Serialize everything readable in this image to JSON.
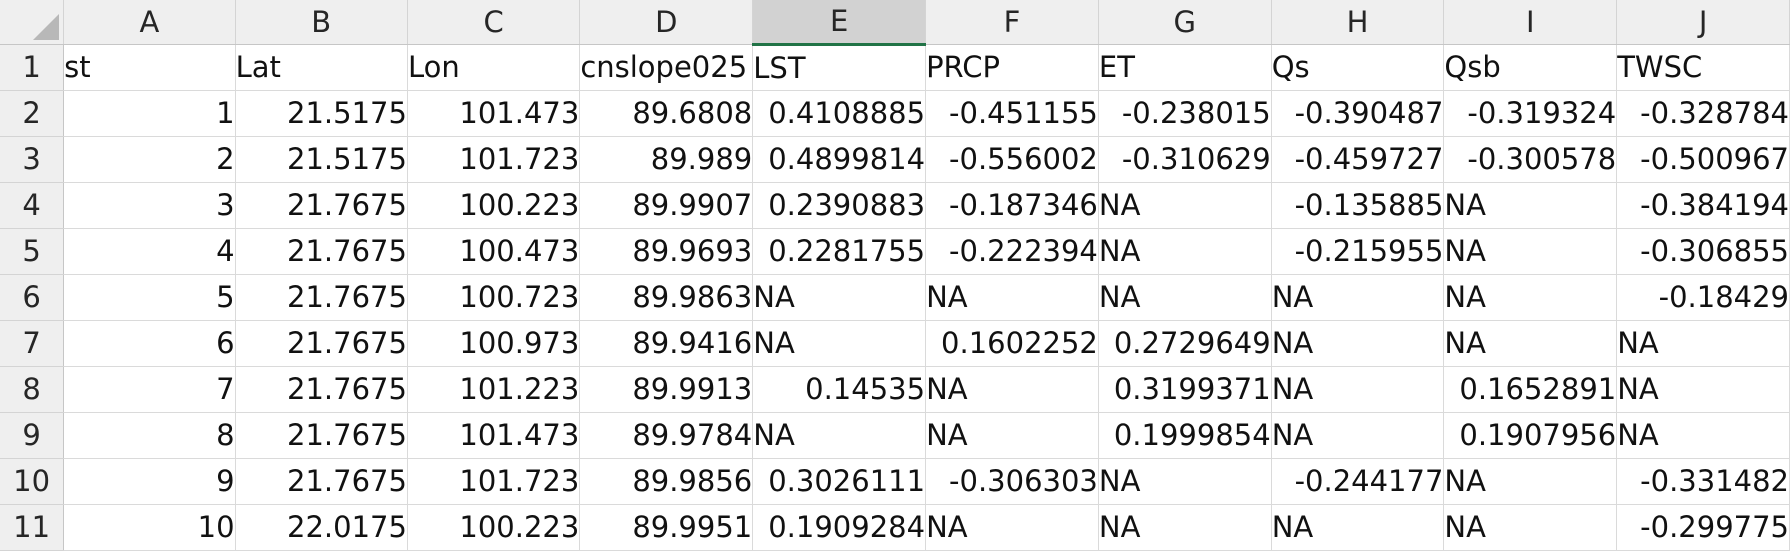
{
  "column_headers": [
    "A",
    "B",
    "C",
    "D",
    "E",
    "F",
    "G",
    "H",
    "I",
    "J"
  ],
  "selected_column": "E",
  "rows": [
    {
      "row": "1",
      "cells": [
        {
          "v": "st",
          "t": "txt"
        },
        {
          "v": "Lat",
          "t": "txt"
        },
        {
          "v": "Lon",
          "t": "txt"
        },
        {
          "v": "cnslope025",
          "t": "txt"
        },
        {
          "v": "LST",
          "t": "txt"
        },
        {
          "v": "PRCP",
          "t": "txt"
        },
        {
          "v": "ET",
          "t": "txt"
        },
        {
          "v": "Qs",
          "t": "txt"
        },
        {
          "v": "Qsb",
          "t": "txt"
        },
        {
          "v": "TWSC",
          "t": "txt"
        }
      ]
    },
    {
      "row": "2",
      "cells": [
        {
          "v": "1",
          "t": "num"
        },
        {
          "v": "21.5175",
          "t": "num"
        },
        {
          "v": "101.473",
          "t": "num"
        },
        {
          "v": "89.6808",
          "t": "num"
        },
        {
          "v": "0.4108885",
          "t": "num"
        },
        {
          "v": "-0.451155",
          "t": "num"
        },
        {
          "v": "-0.238015",
          "t": "num"
        },
        {
          "v": "-0.390487",
          "t": "num"
        },
        {
          "v": "-0.319324",
          "t": "num"
        },
        {
          "v": "-0.328784",
          "t": "num"
        }
      ]
    },
    {
      "row": "3",
      "cells": [
        {
          "v": "2",
          "t": "num"
        },
        {
          "v": "21.5175",
          "t": "num"
        },
        {
          "v": "101.723",
          "t": "num"
        },
        {
          "v": "89.989",
          "t": "num"
        },
        {
          "v": "0.4899814",
          "t": "num"
        },
        {
          "v": "-0.556002",
          "t": "num"
        },
        {
          "v": "-0.310629",
          "t": "num"
        },
        {
          "v": "-0.459727",
          "t": "num"
        },
        {
          "v": "-0.300578",
          "t": "num"
        },
        {
          "v": "-0.500967",
          "t": "num"
        }
      ]
    },
    {
      "row": "4",
      "cells": [
        {
          "v": "3",
          "t": "num"
        },
        {
          "v": "21.7675",
          "t": "num"
        },
        {
          "v": "100.223",
          "t": "num"
        },
        {
          "v": "89.9907",
          "t": "num"
        },
        {
          "v": "0.2390883",
          "t": "num"
        },
        {
          "v": "-0.187346",
          "t": "num"
        },
        {
          "v": "NA",
          "t": "txt"
        },
        {
          "v": "-0.135885",
          "t": "num"
        },
        {
          "v": "NA",
          "t": "txt"
        },
        {
          "v": "-0.384194",
          "t": "num"
        }
      ]
    },
    {
      "row": "5",
      "cells": [
        {
          "v": "4",
          "t": "num"
        },
        {
          "v": "21.7675",
          "t": "num"
        },
        {
          "v": "100.473",
          "t": "num"
        },
        {
          "v": "89.9693",
          "t": "num"
        },
        {
          "v": "0.2281755",
          "t": "num"
        },
        {
          "v": "-0.222394",
          "t": "num"
        },
        {
          "v": "NA",
          "t": "txt"
        },
        {
          "v": "-0.215955",
          "t": "num"
        },
        {
          "v": "NA",
          "t": "txt"
        },
        {
          "v": "-0.306855",
          "t": "num"
        }
      ]
    },
    {
      "row": "6",
      "cells": [
        {
          "v": "5",
          "t": "num"
        },
        {
          "v": "21.7675",
          "t": "num"
        },
        {
          "v": "100.723",
          "t": "num"
        },
        {
          "v": "89.9863",
          "t": "num"
        },
        {
          "v": "NA",
          "t": "txt"
        },
        {
          "v": "NA",
          "t": "txt"
        },
        {
          "v": "NA",
          "t": "txt"
        },
        {
          "v": "NA",
          "t": "txt"
        },
        {
          "v": "NA",
          "t": "txt"
        },
        {
          "v": "-0.18429",
          "t": "num"
        }
      ]
    },
    {
      "row": "7",
      "cells": [
        {
          "v": "6",
          "t": "num"
        },
        {
          "v": "21.7675",
          "t": "num"
        },
        {
          "v": "100.973",
          "t": "num"
        },
        {
          "v": "89.9416",
          "t": "num"
        },
        {
          "v": "NA",
          "t": "txt"
        },
        {
          "v": "0.1602252",
          "t": "num"
        },
        {
          "v": "0.2729649",
          "t": "num"
        },
        {
          "v": "NA",
          "t": "txt"
        },
        {
          "v": "NA",
          "t": "txt"
        },
        {
          "v": "NA",
          "t": "txt"
        }
      ]
    },
    {
      "row": "8",
      "cells": [
        {
          "v": "7",
          "t": "num"
        },
        {
          "v": "21.7675",
          "t": "num"
        },
        {
          "v": "101.223",
          "t": "num"
        },
        {
          "v": "89.9913",
          "t": "num"
        },
        {
          "v": "0.14535",
          "t": "num"
        },
        {
          "v": "NA",
          "t": "txt"
        },
        {
          "v": "0.3199371",
          "t": "num"
        },
        {
          "v": "NA",
          "t": "txt"
        },
        {
          "v": "0.1652891",
          "t": "num"
        },
        {
          "v": "NA",
          "t": "txt"
        }
      ]
    },
    {
      "row": "9",
      "cells": [
        {
          "v": "8",
          "t": "num"
        },
        {
          "v": "21.7675",
          "t": "num"
        },
        {
          "v": "101.473",
          "t": "num"
        },
        {
          "v": "89.9784",
          "t": "num"
        },
        {
          "v": "NA",
          "t": "txt"
        },
        {
          "v": "NA",
          "t": "txt"
        },
        {
          "v": "0.1999854",
          "t": "num"
        },
        {
          "v": "NA",
          "t": "txt"
        },
        {
          "v": "0.1907956",
          "t": "num"
        },
        {
          "v": "NA",
          "t": "txt"
        }
      ]
    },
    {
      "row": "10",
      "cells": [
        {
          "v": "9",
          "t": "num"
        },
        {
          "v": "21.7675",
          "t": "num"
        },
        {
          "v": "101.723",
          "t": "num"
        },
        {
          "v": "89.9856",
          "t": "num"
        },
        {
          "v": "0.3026111",
          "t": "num"
        },
        {
          "v": "-0.306303",
          "t": "num"
        },
        {
          "v": "NA",
          "t": "txt"
        },
        {
          "v": "-0.244177",
          "t": "num"
        },
        {
          "v": "NA",
          "t": "txt"
        },
        {
          "v": "-0.331482",
          "t": "num"
        }
      ]
    },
    {
      "row": "11",
      "cells": [
        {
          "v": "10",
          "t": "num"
        },
        {
          "v": "22.0175",
          "t": "num"
        },
        {
          "v": "100.223",
          "t": "num"
        },
        {
          "v": "89.9951",
          "t": "num"
        },
        {
          "v": "0.1909284",
          "t": "num"
        },
        {
          "v": "NA",
          "t": "txt"
        },
        {
          "v": "NA",
          "t": "txt"
        },
        {
          "v": "NA",
          "t": "txt"
        },
        {
          "v": "NA",
          "t": "txt"
        },
        {
          "v": "-0.299775",
          "t": "num"
        }
      ]
    }
  ],
  "colors": {
    "header_bg": "#efefef",
    "selected_header_bg": "#d2d2d2",
    "selection_accent": "#217346",
    "gridline": "#dadada"
  },
  "icons": {
    "corner": "select-all-triangle-icon"
  }
}
